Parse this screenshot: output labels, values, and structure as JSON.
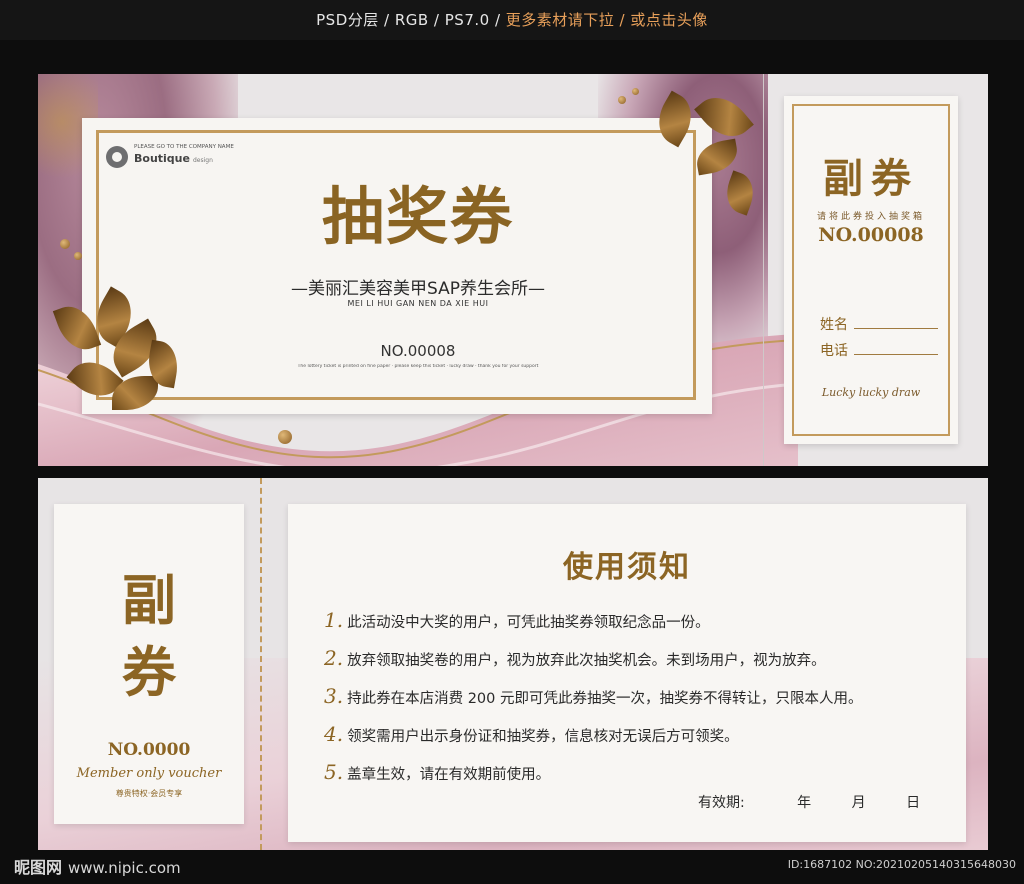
{
  "header": {
    "specs": "PSD分层 / RGB / PS7.0 / ",
    "promo": "更多素材请下拉 / 或点击头像"
  },
  "top_ticket": {
    "brand": {
      "small_text": "PLEASE GO TO THE COMPANY NAME",
      "name": "Boutique",
      "name_sub": "design"
    },
    "title": "抽奖券",
    "subtitle": "—美丽汇美容美甲SAP养生会所—",
    "subtitle_en": "MEI LI HUI GAN NEN DA XIE HUI",
    "number": "NO.00008",
    "fine_print": "The lottery ticket is printed on fine paper · please keep this ticket · lucky draw · thank you for your support",
    "stub": {
      "title": "副券",
      "hint": "请将此券投入抽奖箱",
      "number": "NO.00008",
      "name_label": "姓名",
      "phone_label": "电话",
      "script": "Lucky lucky draw"
    }
  },
  "bottom_ticket": {
    "stub": {
      "char1": "副",
      "char2": "券",
      "number": "NO.0000",
      "script": "Member only voucher",
      "note": "尊贵特权·会员专享"
    },
    "notice": {
      "title": "使用须知",
      "rules": [
        {
          "num": "1.",
          "text": "此活动没中大奖的用户，可凭此抽奖券领取纪念品一份。"
        },
        {
          "num": "2.",
          "text": "放弃领取抽奖卷的用户，视为放弃此次抽奖机会。未到场用户，视为放弃。"
        },
        {
          "num": "3.",
          "text": "持此券在本店消费 200 元即可凭此券抽奖一次，抽奖券不得转让，只限本人用。"
        },
        {
          "num": "4.",
          "text": "领奖需用户出示身份证和抽奖券，信息核对无误后方可领奖。"
        },
        {
          "num": "5.",
          "text": "盖章生效，请在有效期前使用。"
        }
      ],
      "valid_label": "有效期:",
      "year": "年",
      "month": "月",
      "day": "日"
    }
  },
  "footer": {
    "site_name": "昵图网",
    "site_url": "www.nipic.com",
    "id_text": "ID:1687102 NO:20210205140315648030"
  },
  "colors": {
    "gold": "#8c6524",
    "gold_frame": "#c39a5c",
    "promo": "#e8a05a",
    "pink_marble": "#dcb3c0",
    "mauve_marble": "#9b6d82"
  }
}
